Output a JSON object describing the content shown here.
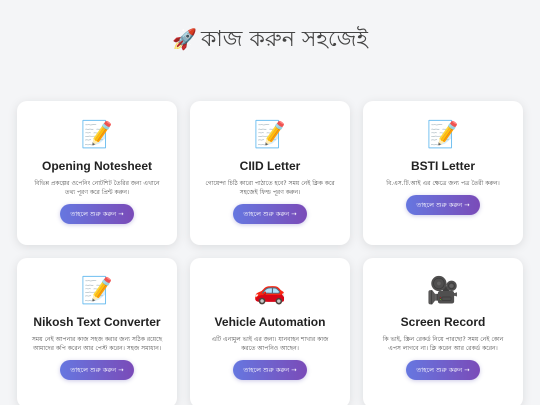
{
  "header": {
    "icon": "rocket-icon",
    "title": "কাজ করুন সহজেই"
  },
  "colors": {
    "background": "#f4f5f7",
    "button_gradient_start": "#6677e0",
    "button_gradient_end": "#7a4bb8"
  },
  "cards": [
    {
      "icon": "memo-icon",
      "title": "Opening Notesheet",
      "description": "বিভিন্ন প্রকল্পের ওপেনিং নোটশিট তৈরির জন্য এখানে তথ্য পূরণ করে প্রিন্ট করুন।",
      "button": "তাহলে শুরু করুন →"
    },
    {
      "icon": "memo-icon",
      "title": "CIID Letter",
      "description": "গোয়েন্দা চিঠি কারো পাঠাতে হবে? সময় নেই ক্লিক করে সহজেই ফিল্ড পূরণ করুন।",
      "button": "তাহলে শুরু করুন →"
    },
    {
      "icon": "memo-icon",
      "title": "BSTI Letter",
      "description": "বি.এস.টি.আই এর ক্ষেত্রে জন্য পত্র তৈরী করুন।",
      "button": "তাহলে শুরু করুন →"
    },
    {
      "icon": "memo-icon",
      "title": "Nikosh Text Converter",
      "description": "সময় নেই আপনার কাজ সহজ করার জন্য সঠিক রয়েছে আমাদের কপি করেন আর পেস্ট করেন। সহজ সমাধান।",
      "button": "তাহলে শুরু করুন →"
    },
    {
      "icon": "car-icon",
      "title": "Vehicle Automation",
      "description": "এটি এনামুল ভাই এর জন্য। যানবাহন শাখার কাজ করতে আপনিও আছেন।",
      "button": "তাহলে শুরু করুন →"
    },
    {
      "icon": "film-camera-icon",
      "title": "Screen Record",
      "description": "কি ভাই, স্ক্রিন রেকর্ড নিয়ে পারছো? সময় নেই কোন এপস লাগবে না। ক্লি করেন আর রেকর্ড করেন।",
      "button": "তাহলে শুরু করুন →"
    }
  ]
}
